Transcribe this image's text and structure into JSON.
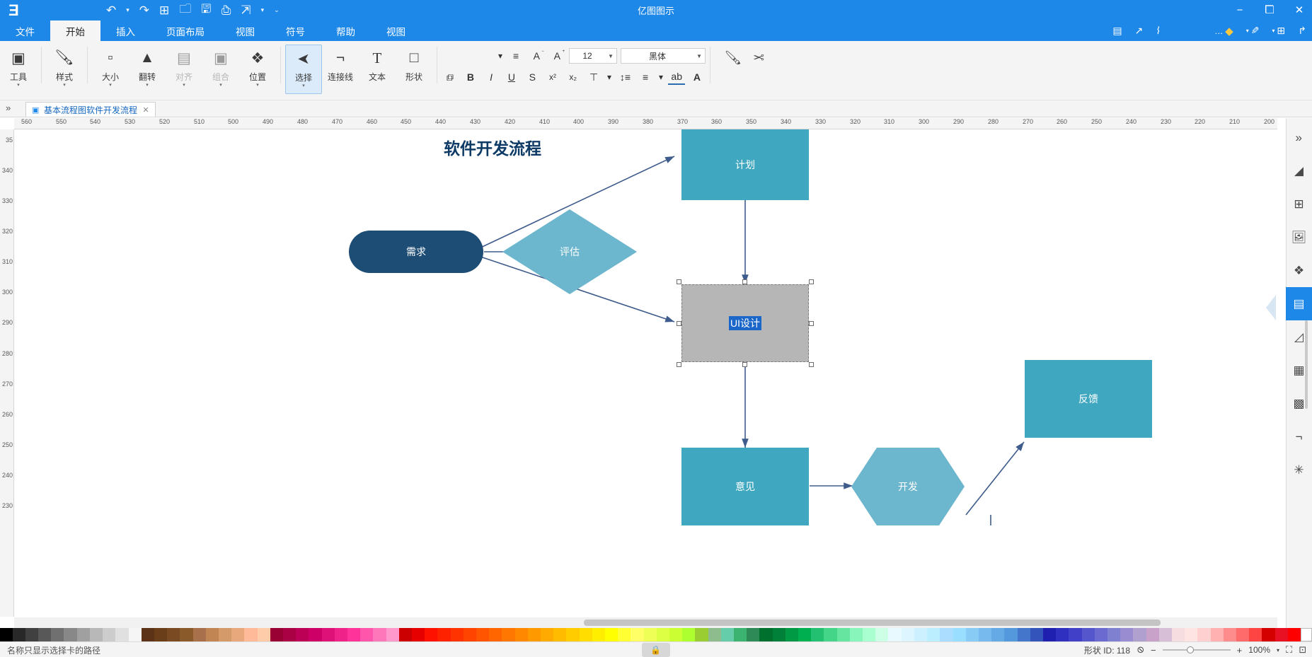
{
  "app": {
    "title": "亿图图示",
    "window_buttons": [
      "close",
      "maximize",
      "minimize"
    ],
    "logo": "E"
  },
  "quick_access": {
    "items": [
      {
        "name": "customize-quick-access",
        "glyph": "⌄"
      },
      {
        "name": "redo-dropdown",
        "glyph": "↷"
      },
      {
        "name": "undo",
        "glyph": "↶"
      },
      {
        "name": "new-page",
        "glyph": "⊞"
      },
      {
        "name": "open-file",
        "glyph": "🗀"
      },
      {
        "name": "save",
        "glyph": "🖫"
      },
      {
        "name": "print",
        "glyph": "🖨"
      },
      {
        "name": "export",
        "glyph": "↗"
      }
    ]
  },
  "tabs": [
    {
      "label": "文件",
      "active": false
    },
    {
      "label": "开始",
      "active": true
    },
    {
      "label": "插入",
      "active": false
    },
    {
      "label": "页面布局",
      "active": false
    },
    {
      "label": "视图",
      "active": false
    },
    {
      "label": "符号",
      "active": false
    },
    {
      "label": "帮助",
      "active": false
    }
  ],
  "left_tools": [
    {
      "name": "pointer-tool",
      "glyph": "➤"
    },
    {
      "name": "more-tool",
      "glyph": "…"
    },
    {
      "name": "highlighter-tool",
      "glyph": "◆"
    },
    {
      "name": "format-painter-tool",
      "glyph": "✎"
    },
    {
      "name": "grid-tool",
      "glyph": "⊞"
    },
    {
      "name": "undo-arrow-tool",
      "glyph": "↰"
    },
    {
      "name": "comment-tool",
      "glyph": "▤"
    },
    {
      "name": "cursor-tool",
      "glyph": "↖"
    },
    {
      "name": "connector-tool",
      "glyph": "⌇"
    }
  ],
  "ribbon": {
    "groups": [
      {
        "name": "shape",
        "label": "形状",
        "icon": "□",
        "has_dropdown": false,
        "selected": false,
        "disabled": false
      },
      {
        "name": "text",
        "label": "文本",
        "icon": "T",
        "has_dropdown": false,
        "selected": false,
        "disabled": false
      },
      {
        "name": "connector",
        "label": "连接线",
        "icon": "⌐",
        "has_dropdown": true,
        "selected": false,
        "disabled": false
      },
      {
        "name": "select",
        "label": "选择",
        "icon": "➤",
        "has_dropdown": true,
        "selected": true,
        "disabled": false
      },
      {
        "name": "position",
        "label": "位置",
        "icon": "❖",
        "has_dropdown": true,
        "selected": false,
        "disabled": false
      },
      {
        "name": "group",
        "label": "组合",
        "icon": "▣",
        "has_dropdown": true,
        "selected": false,
        "disabled": true
      },
      {
        "name": "align",
        "label": "对齐",
        "icon": "▤",
        "has_dropdown": true,
        "selected": false,
        "disabled": true
      },
      {
        "name": "flip",
        "label": "翻转",
        "icon": "▲",
        "has_dropdown": true,
        "selected": false,
        "disabled": false
      },
      {
        "name": "size",
        "label": "大小",
        "icon": "▫",
        "has_dropdown": true,
        "selected": false,
        "disabled": false
      },
      {
        "name": "style",
        "label": "样式",
        "icon": "🖌",
        "has_dropdown": true,
        "selected": false,
        "disabled": false
      },
      {
        "name": "tools",
        "label": "工具",
        "icon": "▣",
        "has_dropdown": true,
        "selected": false,
        "disabled": false
      }
    ],
    "font": {
      "family_value": "黑体",
      "size_value": "12",
      "increase_size": "A⁺",
      "decrease_size": "A⁻",
      "buttons_row1": [
        {
          "name": "decrease-font-size-button",
          "glyph": "A"
        },
        {
          "name": "increase-font-size-button",
          "glyph": "A"
        },
        {
          "name": "text-align-button",
          "glyph": "≡"
        }
      ],
      "buttons_row2": [
        {
          "name": "bold-button",
          "glyph": "B"
        },
        {
          "name": "italic-button",
          "glyph": "I"
        },
        {
          "name": "underline-button",
          "glyph": "U"
        },
        {
          "name": "strikethrough-button",
          "glyph": "S"
        },
        {
          "name": "superscript-button",
          "glyph": "x²"
        },
        {
          "name": "subscript-button",
          "glyph": "x₂"
        },
        {
          "name": "line-spacing-button",
          "glyph": "↕≡"
        },
        {
          "name": "text-direction-button",
          "glyph": "≡"
        },
        {
          "name": "font-color-button",
          "glyph": "ab"
        },
        {
          "name": "text-highlight-button",
          "glyph": "A"
        }
      ]
    },
    "right_tools": [
      {
        "name": "cut-button",
        "glyph": "✂"
      },
      {
        "name": "copy-button",
        "glyph": "⧉"
      },
      {
        "name": "paste-button",
        "glyph": "📋"
      },
      {
        "name": "format-painter-button",
        "glyph": "🖌"
      }
    ]
  },
  "doc_tab": {
    "label": "基本流程图软件开发流程",
    "close_glyph": "✕",
    "doc_icon": "▣",
    "collapse_glyph": "«"
  },
  "rail": {
    "items": [
      {
        "name": "expand-panel",
        "glyph": "»",
        "active": false
      },
      {
        "name": "eraser-tool",
        "glyph": "◣",
        "active": false
      },
      {
        "name": "symbols-library",
        "glyph": "⊞",
        "active": false
      },
      {
        "name": "image-library",
        "glyph": "🖼",
        "active": false
      },
      {
        "name": "layers-panel",
        "glyph": "❖",
        "active": false
      },
      {
        "name": "pages-panel",
        "glyph": "▤",
        "active": true
      },
      {
        "name": "chart-tool",
        "glyph": "◺",
        "active": false
      },
      {
        "name": "table-tool",
        "glyph": "▦",
        "active": false
      },
      {
        "name": "container-tool",
        "glyph": "▩",
        "active": false
      },
      {
        "name": "callout-tool",
        "glyph": "⌐",
        "active": false
      },
      {
        "name": "scatter-tool",
        "glyph": "✳",
        "active": false
      }
    ]
  },
  "canvas": {
    "diagram_title": "软件开发流程",
    "ruler_h_ticks": [
      "200",
      "210",
      "220",
      "230",
      "240",
      "250",
      "260",
      "270",
      "280",
      "290",
      "300",
      "310",
      "320",
      "330",
      "340",
      "350",
      "360",
      "370",
      "380",
      "390",
      "400",
      "410",
      "420",
      "430",
      "440",
      "450",
      "460",
      "470",
      "480",
      "490",
      "500",
      "510",
      "520",
      "530",
      "540",
      "550",
      "560"
    ],
    "ruler_v_ticks": [
      "35",
      "340",
      "330",
      "320",
      "310",
      "300",
      "290",
      "280",
      "270",
      "260",
      "250",
      "240",
      "230"
    ],
    "shapes": [
      {
        "name": "shape-requirement",
        "label": "需求",
        "type": "rounded-rect",
        "color": "#1D4C74"
      },
      {
        "name": "shape-evaluate",
        "label": "评估",
        "type": "diamond",
        "color": "#6CB6CE"
      },
      {
        "name": "shape-plan",
        "label": "计划",
        "type": "rect",
        "color": "#3FA7BF"
      },
      {
        "name": "shape-design",
        "label": "UI设计",
        "type": "rect",
        "color": "#B6B6B6",
        "selected": true
      },
      {
        "name": "shape-feedback",
        "label": "反馈",
        "type": "rect",
        "color": "#3FA7BF"
      },
      {
        "name": "shape-opinion",
        "label": "意见",
        "type": "rect",
        "color": "#3FA7BF"
      },
      {
        "name": "shape-develop",
        "label": "开发",
        "type": "hexagon",
        "color": "#6CB6CE"
      }
    ]
  },
  "status": {
    "page_info": "形状 ID: 118",
    "zoom_value": "100%",
    "zoom_out_glyph": "−",
    "zoom_in_glyph": "+",
    "reset_glyph": "⊘",
    "fit_page_glyph": "⛶",
    "full_screen_glyph": "⊡",
    "right_text": "名称只显示选择卡的路径",
    "center_lock_glyph": "🔒"
  },
  "palette": {
    "colors": [
      "#FF0000",
      "#E81123",
      "#D40000",
      "#FF4444",
      "#FF6A6A",
      "#FF8C8C",
      "#FFB0B0",
      "#FFD0D0",
      "#FFE4E4",
      "#F5DDE0",
      "#D8BFD8",
      "#C8A2C8",
      "#B0A0D0",
      "#9A8CD0",
      "#8080D0",
      "#6A6AD0",
      "#5555CC",
      "#4040C8",
      "#3030C0",
      "#2020B0",
      "#3355BB",
      "#4477CC",
      "#5599DD",
      "#66AAE5",
      "#77BBEE",
      "#88CCF5",
      "#99DDFF",
      "#AADDFF",
      "#BBEEFF",
      "#CCF0FF",
      "#DDF5FF",
      "#E8FAFF",
      "#CCFFE5",
      "#AAFFD0",
      "#88F5BB",
      "#66E5A0",
      "#44D588",
      "#22C070",
      "#00B050",
      "#009944",
      "#008038",
      "#00702F",
      "#2E8B57",
      "#3CB371",
      "#66CDAA",
      "#8FBC8F",
      "#9ACD32",
      "#ADFF2F",
      "#CCFF33",
      "#DDFF44",
      "#EEFF55",
      "#FFFF66",
      "#FFFF33",
      "#FFFF00",
      "#FFEE00",
      "#FFDD00",
      "#FFCC00",
      "#FFBB00",
      "#FFAA00",
      "#FF9900",
      "#FF8800",
      "#FF7700",
      "#FF6600",
      "#FF5500",
      "#FF4400",
      "#FF3300",
      "#FF2200",
      "#FF1100",
      "#E60000",
      "#CC0000",
      "#FF99CC",
      "#FF77BB",
      "#FF55AA",
      "#FF3399",
      "#EE2288",
      "#DD1177",
      "#CC0066",
      "#BB0055",
      "#AA0044",
      "#990033",
      "#FFCCAA",
      "#FFBB99",
      "#E8A87C",
      "#D49A6A",
      "#C08552",
      "#A9714B",
      "#8B5A2B",
      "#7A4A22",
      "#6B3E1A",
      "#5C3317",
      "#F5F5F5",
      "#E0E0E0",
      "#CCCCCC",
      "#B8B8B8",
      "#A0A0A0",
      "#888888",
      "#707070",
      "#585858",
      "#404040",
      "#282828",
      "#000000"
    ]
  }
}
